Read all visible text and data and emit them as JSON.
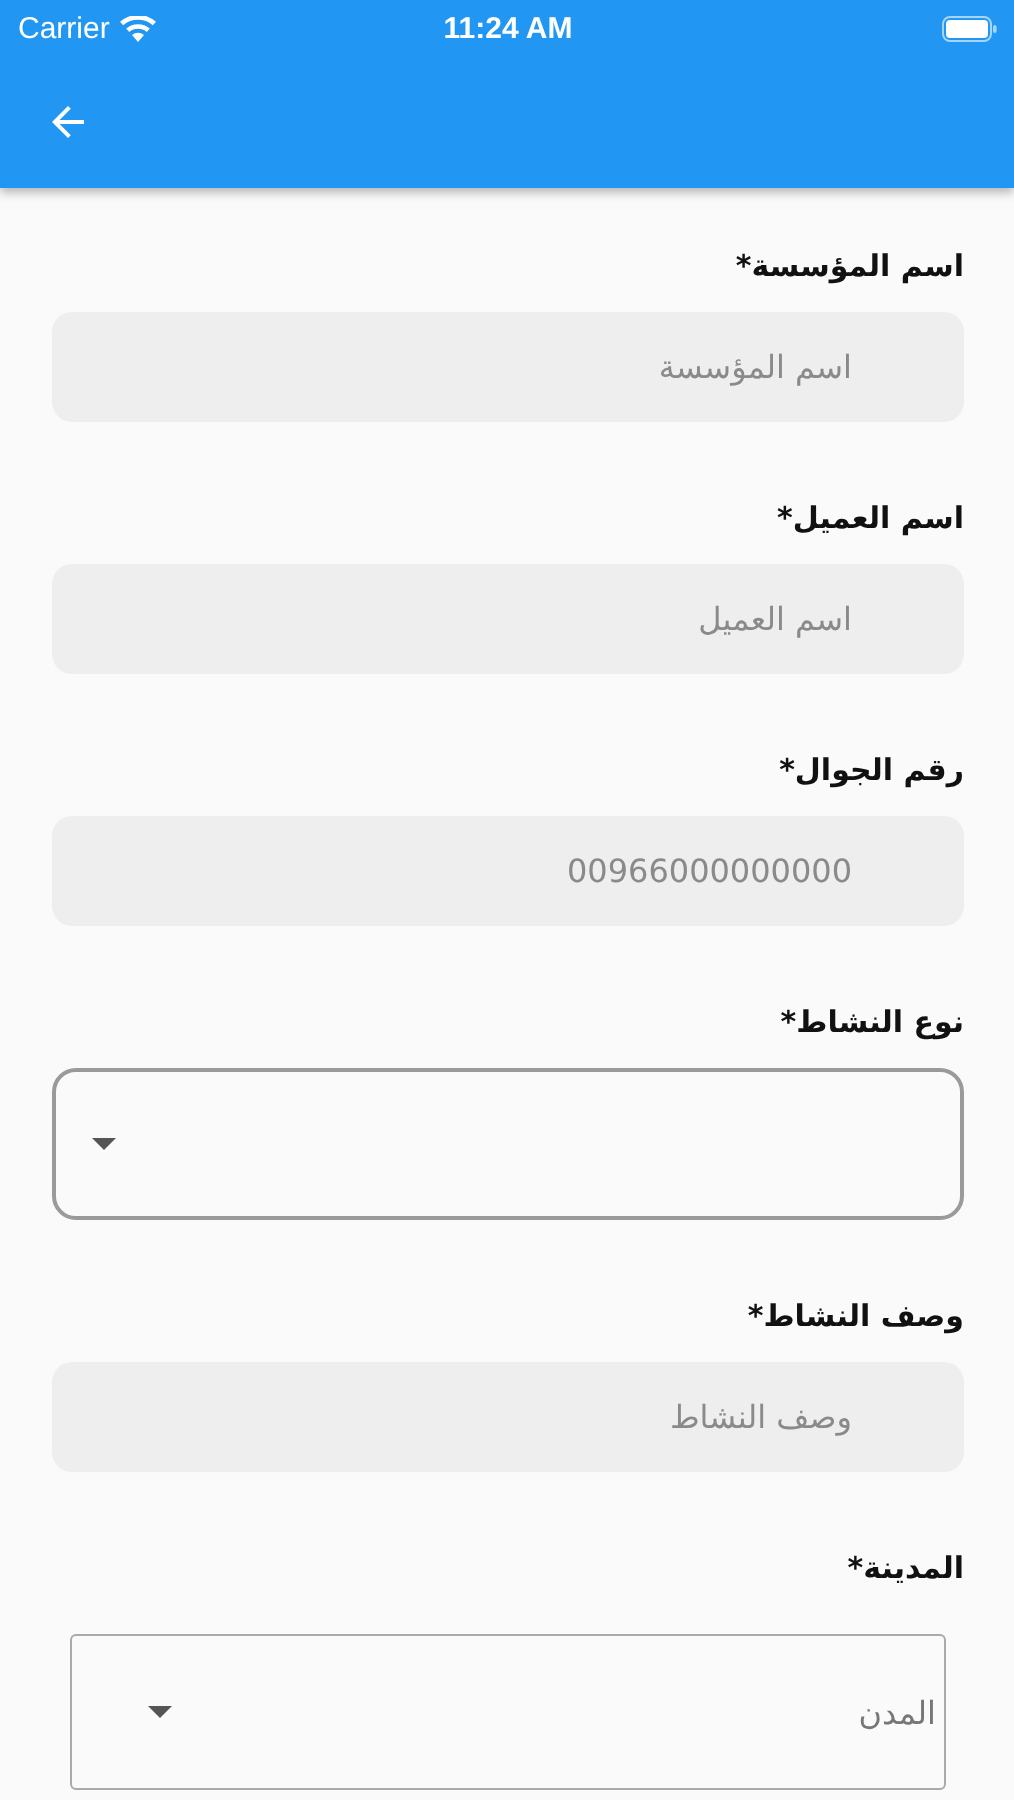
{
  "status_bar": {
    "carrier": "Carrier",
    "time": "11:24 AM"
  },
  "fields": [
    {
      "kind": "text",
      "label": "اسم المؤسسة*",
      "placeholder": "اسم المؤسسة"
    },
    {
      "kind": "text",
      "label": "اسم العميل*",
      "placeholder": "اسم العميل"
    },
    {
      "kind": "text",
      "label": "رقم الجوال*",
      "placeholder": "00966000000000"
    },
    {
      "kind": "dropdown",
      "label": "نوع النشاط*"
    },
    {
      "kind": "text",
      "label": "وصف النشاط*",
      "placeholder": "وصف النشاط"
    },
    {
      "kind": "select",
      "label": "المدينة*",
      "value": "المدن"
    }
  ]
}
